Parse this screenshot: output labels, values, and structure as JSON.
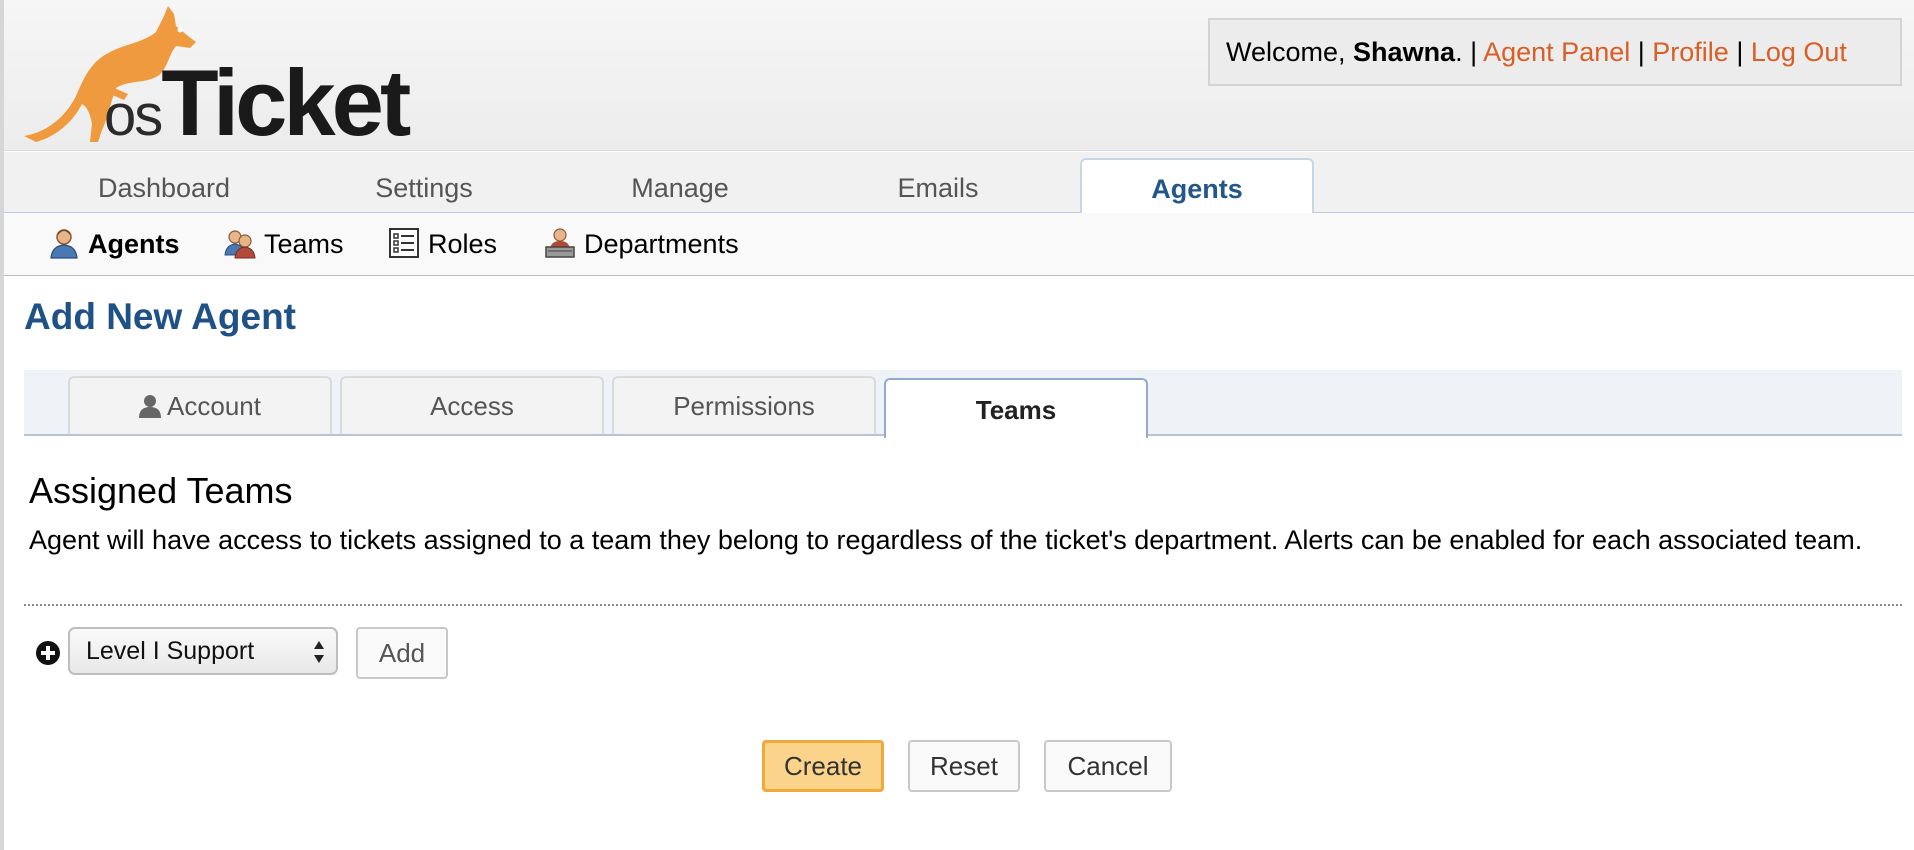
{
  "header": {
    "logo_text_os": "os",
    "logo_text_ticket": "Ticket",
    "welcome_prefix": "Welcome, ",
    "user_name": "Shawna",
    "welcome_suffix": ".",
    "separator": " | ",
    "links": [
      "Agent Panel",
      "Profile",
      "Log Out"
    ],
    "link_color": "#d95f26"
  },
  "main_nav": {
    "tabs": [
      {
        "label": "Dashboard"
      },
      {
        "label": "Settings"
      },
      {
        "label": "Manage"
      },
      {
        "label": "Emails"
      },
      {
        "label": "Agents",
        "active": true
      }
    ]
  },
  "sub_nav": {
    "items": [
      {
        "label": "Agents",
        "icon": "agent-icon",
        "active": true
      },
      {
        "label": "Teams",
        "icon": "teams-icon"
      },
      {
        "label": "Roles",
        "icon": "roles-list-icon"
      },
      {
        "label": "Departments",
        "icon": "department-icon"
      }
    ]
  },
  "page": {
    "title": "Add New Agent",
    "title_color": "#1e5287",
    "tabs": [
      {
        "label": "Account",
        "icon": "person-icon"
      },
      {
        "label": "Access"
      },
      {
        "label": "Permissions"
      },
      {
        "label": "Teams",
        "active": true
      }
    ]
  },
  "section": {
    "title": "Assigned Teams",
    "description": "Agent will have access to tickets assigned to a team they belong to regardless of the ticket's department. Alerts can be enabled for each associated team."
  },
  "team_picker": {
    "selected": "Level I Support",
    "add_label": "Add"
  },
  "actions": {
    "create": "Create",
    "reset": "Reset",
    "cancel": "Cancel",
    "create_color": "#fcd38a"
  }
}
